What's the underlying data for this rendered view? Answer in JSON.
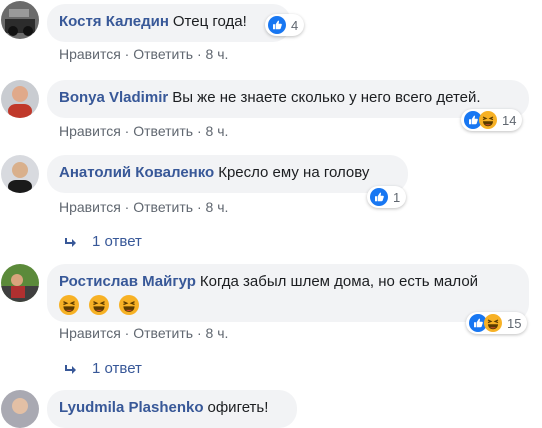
{
  "comments": [
    {
      "author": "Костя Каледин",
      "text": "Отец года!",
      "reactions": "4",
      "like_label": "Нравится",
      "reply_label": "Ответить",
      "time": "8 ч."
    },
    {
      "author": "Bonya Vladimir",
      "text": "Вы же не знаете сколько у него всего детей.",
      "reactions": "14",
      "like_label": "Нравится",
      "reply_label": "Ответить",
      "time": "8 ч."
    },
    {
      "author": "Анатолий Коваленко",
      "text": "Кресло ему на голову",
      "reactions": "1",
      "like_label": "Нравится",
      "reply_label": "Ответить",
      "time": "8 ч.",
      "replies": "1 ответ"
    },
    {
      "author": "Ростислав Майгур",
      "text": "Когда забыл шлем дома, но есть малой",
      "emojis": "😂😂😂",
      "reactions": "15",
      "like_label": "Нравится",
      "reply_label": "Ответить",
      "time": "8 ч.",
      "replies": "1 ответ"
    },
    {
      "author": "Lyudmila Plashenko",
      "text": "офигеть!"
    }
  ],
  "separator": "·",
  "colors": {
    "link": "#385898",
    "bubble": "#f2f3f5",
    "like": "#1877f2",
    "haha": "#f7b125"
  }
}
